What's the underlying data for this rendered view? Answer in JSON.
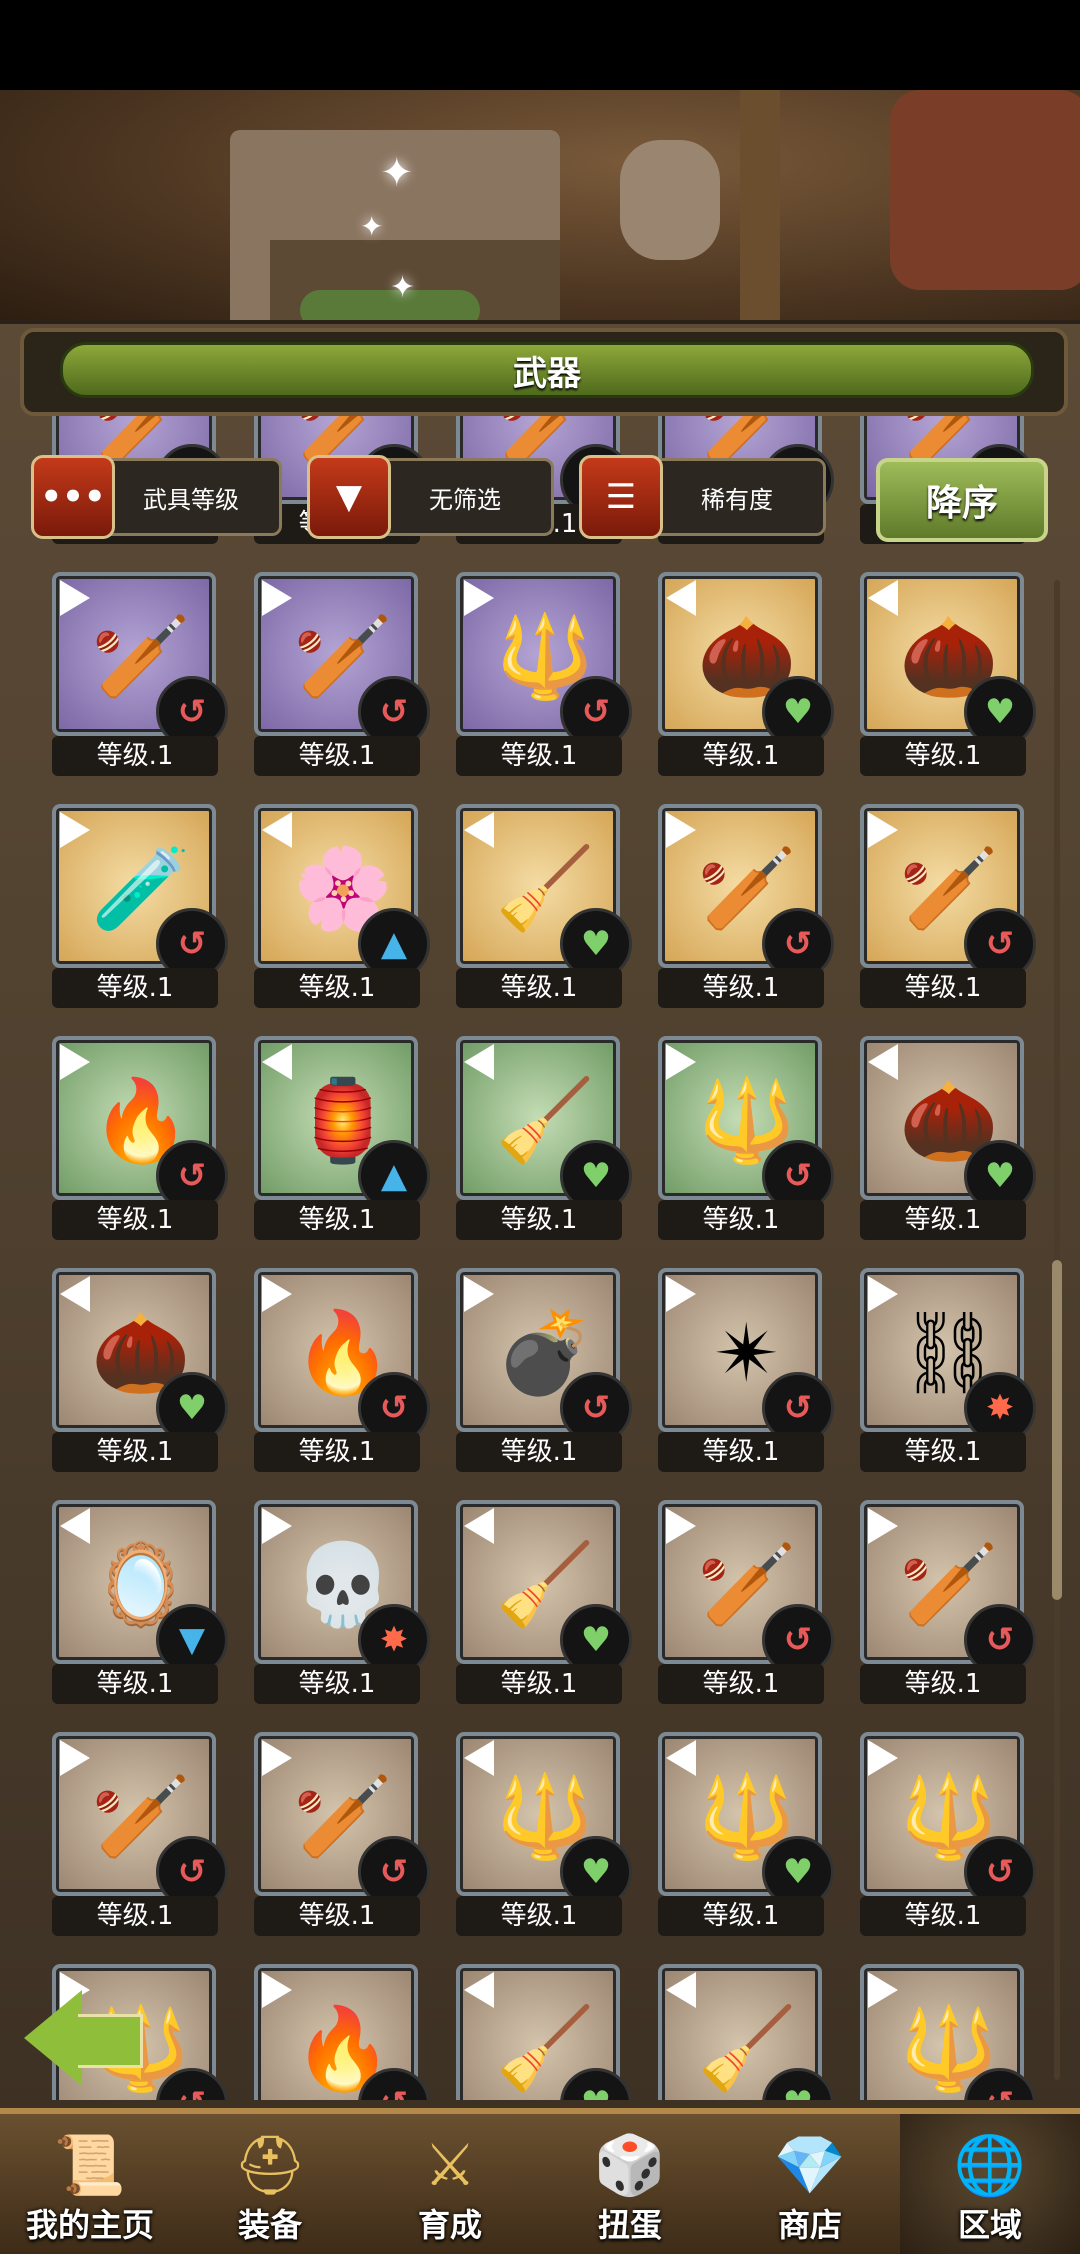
{
  "header": {
    "title": "武器"
  },
  "toolbar": {
    "sort_type_label": "武具等级",
    "sort_type_icon": "ellipsis-icon",
    "filter_label": "无筛选",
    "filter_icon": "funnel-icon",
    "rarity_label": "稀有度",
    "rarity_icon": "bars-icon",
    "order_label": "降序"
  },
  "level_text": "等级.1",
  "colors": {
    "purple": "#7a66a4",
    "gold": "#d4a454",
    "green": "#6e9a64",
    "brown": "#9a8470"
  },
  "items": [
    {
      "rarity": "purple",
      "icon": "club-icon",
      "badge": "swirl",
      "pointer": "right"
    },
    {
      "rarity": "purple",
      "icon": "club-icon",
      "badge": "heart",
      "pointer": "right"
    },
    {
      "rarity": "purple",
      "icon": "club-icon",
      "badge": "heart",
      "pointer": "right"
    },
    {
      "rarity": "purple",
      "icon": "club-icon",
      "badge": "heart",
      "pointer": "right"
    },
    {
      "rarity": "purple",
      "icon": "club-icon",
      "badge": "swirl",
      "pointer": "right"
    },
    {
      "rarity": "purple",
      "icon": "club-icon",
      "badge": "swirl",
      "pointer": "right"
    },
    {
      "rarity": "purple",
      "icon": "club-icon",
      "badge": "swirl",
      "pointer": "right"
    },
    {
      "rarity": "purple",
      "icon": "mace-icon",
      "badge": "swirl",
      "pointer": "right"
    },
    {
      "rarity": "gold",
      "icon": "seed-icon",
      "badge": "heart",
      "pointer": "left"
    },
    {
      "rarity": "gold",
      "icon": "seed-icon",
      "badge": "heart",
      "pointer": "left"
    },
    {
      "rarity": "gold",
      "icon": "potion-icon",
      "badge": "swirl",
      "pointer": "right"
    },
    {
      "rarity": "gold",
      "icon": "flower-ball-icon",
      "badge": "up",
      "pointer": "left"
    },
    {
      "rarity": "gold",
      "icon": "broom-icon",
      "badge": "heart",
      "pointer": "left"
    },
    {
      "rarity": "gold",
      "icon": "club-icon",
      "badge": "swirl",
      "pointer": "right"
    },
    {
      "rarity": "gold",
      "icon": "spiked-club-icon",
      "badge": "swirl",
      "pointer": "right"
    },
    {
      "rarity": "green",
      "icon": "torch-sack-icon",
      "badge": "swirl",
      "pointer": "right"
    },
    {
      "rarity": "green",
      "icon": "lantern-icon",
      "badge": "up",
      "pointer": "left"
    },
    {
      "rarity": "green",
      "icon": "broom-icon",
      "badge": "heart",
      "pointer": "left"
    },
    {
      "rarity": "green",
      "icon": "mace-icon",
      "badge": "swirl",
      "pointer": "right"
    },
    {
      "rarity": "brown",
      "icon": "seed-icon",
      "badge": "heart",
      "pointer": "left"
    },
    {
      "rarity": "brown",
      "icon": "seed-icon",
      "badge": "heart",
      "pointer": "left"
    },
    {
      "rarity": "brown",
      "icon": "torch-sack-icon",
      "badge": "swirl",
      "pointer": "right"
    },
    {
      "rarity": "brown",
      "icon": "crystal-bomb-icon",
      "badge": "swirl",
      "pointer": "right"
    },
    {
      "rarity": "brown",
      "icon": "cube-star-icon",
      "badge": "swirl",
      "pointer": "right"
    },
    {
      "rarity": "brown",
      "icon": "chain-orb-icon",
      "badge": "burst",
      "pointer": "right"
    },
    {
      "rarity": "brown",
      "icon": "mirror-icon",
      "badge": "down",
      "pointer": "left"
    },
    {
      "rarity": "brown",
      "icon": "skull-icon",
      "badge": "burst",
      "pointer": "right"
    },
    {
      "rarity": "brown",
      "icon": "broom-icon",
      "badge": "heart",
      "pointer": "left"
    },
    {
      "rarity": "brown",
      "icon": "club-icon",
      "badge": "swirl",
      "pointer": "right"
    },
    {
      "rarity": "brown",
      "icon": "club-icon",
      "badge": "swirl",
      "pointer": "right"
    },
    {
      "rarity": "brown",
      "icon": "fire-club-icon",
      "badge": "swirl",
      "pointer": "right"
    },
    {
      "rarity": "brown",
      "icon": "fire-club-icon",
      "badge": "swirl",
      "pointer": "right"
    },
    {
      "rarity": "brown",
      "icon": "spear-icon",
      "badge": "heart",
      "pointer": "left"
    },
    {
      "rarity": "brown",
      "icon": "spear-icon",
      "badge": "heart",
      "pointer": "left"
    },
    {
      "rarity": "brown",
      "icon": "mace-icon",
      "badge": "swirl",
      "pointer": "right"
    },
    {
      "rarity": "brown",
      "icon": "mace-icon",
      "badge": "swirl",
      "pointer": "right"
    },
    {
      "rarity": "brown",
      "icon": "torch-sack-icon",
      "badge": "swirl",
      "pointer": "right"
    },
    {
      "rarity": "brown",
      "icon": "broom-icon",
      "badge": "heart",
      "pointer": "left"
    },
    {
      "rarity": "brown",
      "icon": "broom-icon",
      "badge": "heart",
      "pointer": "left"
    },
    {
      "rarity": "brown",
      "icon": "mace-icon",
      "badge": "swirl",
      "pointer": "right"
    }
  ],
  "nav": {
    "items": [
      {
        "label": "我的主页",
        "icon": "scroll-map-icon"
      },
      {
        "label": "装备",
        "icon": "helmet-icon"
      },
      {
        "label": "育成",
        "icon": "sword-icon"
      },
      {
        "label": "扭蛋",
        "icon": "gacha-icon"
      },
      {
        "label": "商店",
        "icon": "gem-icon"
      },
      {
        "label": "区域",
        "icon": "globe-icon"
      }
    ],
    "active_index": 5
  }
}
